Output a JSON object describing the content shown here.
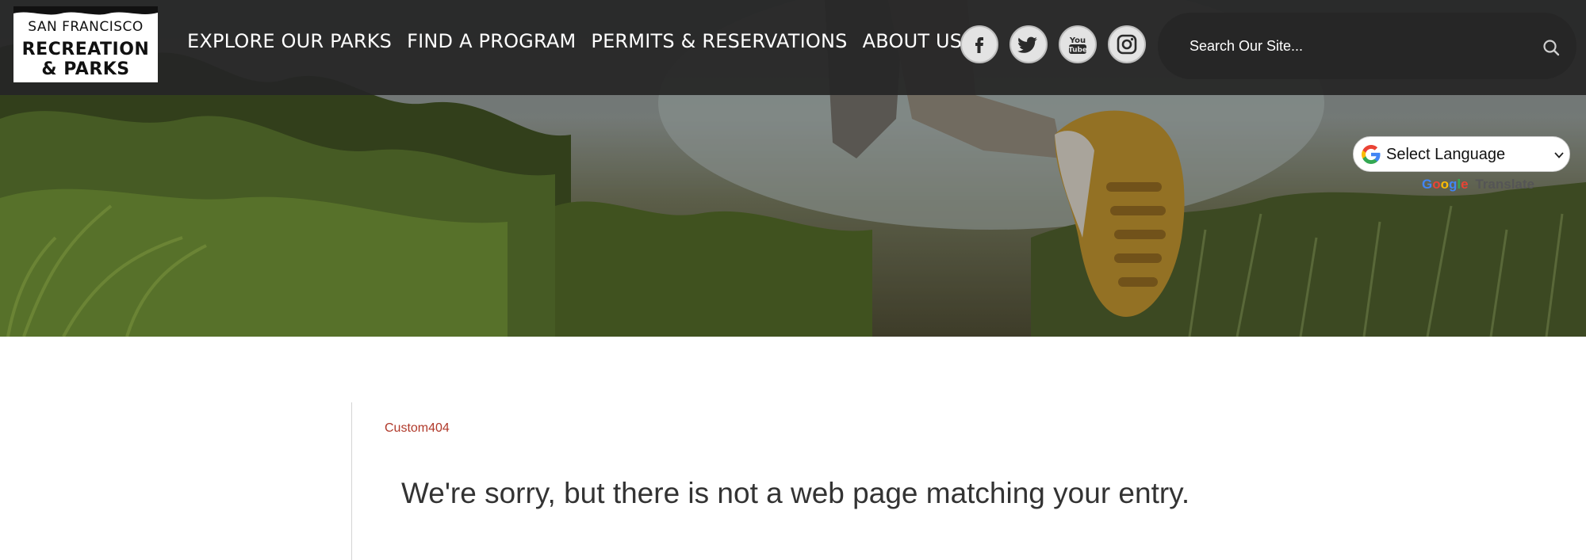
{
  "header": {
    "logo": {
      "line1": "SAN FRANCISCO",
      "line2": "RECREATION",
      "line3": "& PARKS"
    },
    "nav": [
      {
        "label": "EXPLORE OUR PARKS"
      },
      {
        "label": "FIND A PROGRAM"
      },
      {
        "label": "PERMITS & RESERVATIONS"
      },
      {
        "label": "ABOUT US"
      }
    ],
    "social": [
      {
        "icon": "facebook-icon"
      },
      {
        "icon": "twitter-icon"
      },
      {
        "icon": "youtube-icon"
      },
      {
        "icon": "instagram-icon"
      }
    ],
    "search": {
      "placeholder": "Search Our Site...",
      "icon": "search-icon"
    }
  },
  "translate": {
    "select_label": "Select Language",
    "powered_brand": "Google",
    "powered_word": "Translate"
  },
  "content": {
    "breadcrumb": "Custom404",
    "message": "We're sorry, but there is not a web page matching your entry."
  },
  "colors": {
    "header_bg": "#262626",
    "breadcrumb": "#b0392a",
    "message_text": "#333333"
  }
}
